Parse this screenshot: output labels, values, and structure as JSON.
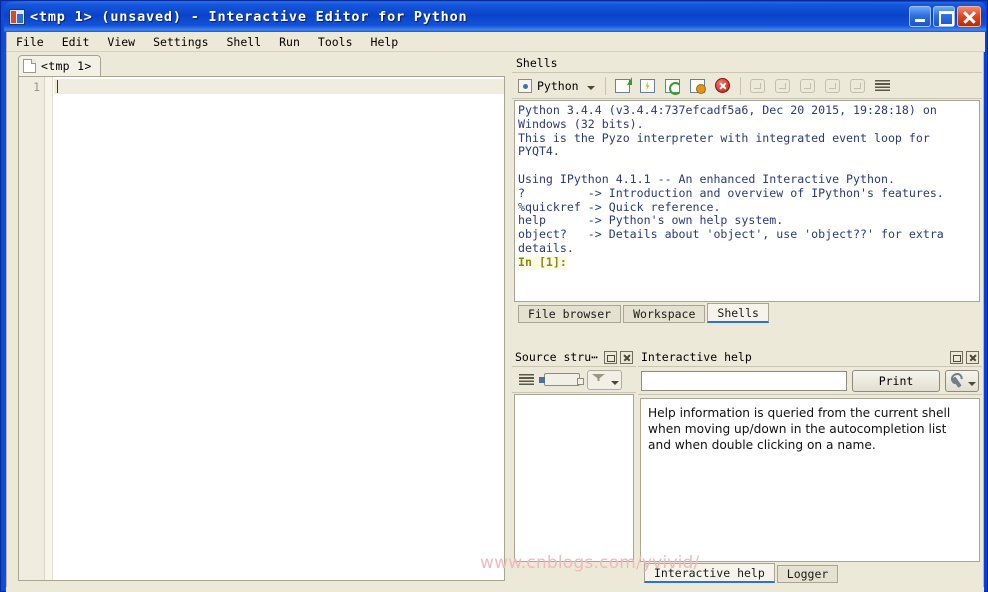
{
  "window": {
    "title": "<tmp 1> (unsaved) - Interactive Editor for Python",
    "icon": "pyzo-app-icon",
    "controls": {
      "minimize": "minimize-button",
      "maximize": "maximize-button",
      "close": "close-button"
    }
  },
  "menubar": {
    "items": [
      {
        "label": "File"
      },
      {
        "label": "Edit"
      },
      {
        "label": "View"
      },
      {
        "label": "Settings"
      },
      {
        "label": "Shell"
      },
      {
        "label": "Run"
      },
      {
        "label": "Tools"
      },
      {
        "label": "Help"
      }
    ]
  },
  "editor": {
    "tab": {
      "label": "<tmp 1>",
      "icon": "document-icon"
    },
    "lines": [
      {
        "number": "1",
        "text": ""
      }
    ]
  },
  "shells": {
    "panel_title": "Shells",
    "selector": {
      "label": "Python",
      "icon": "python-shell-icon"
    },
    "toolbar": [
      {
        "name": "new-shell-icon"
      },
      {
        "name": "debug-shell-icon"
      },
      {
        "name": "restart-shell-icon"
      },
      {
        "name": "shell-config-icon"
      },
      {
        "name": "terminate-shell-icon"
      },
      {
        "name": "debug-pause-icon"
      },
      {
        "name": "debug-step-icon"
      },
      {
        "name": "debug-stepin-icon"
      },
      {
        "name": "debug-stepout-icon"
      },
      {
        "name": "debug-stop-icon"
      },
      {
        "name": "postmortem-icon"
      }
    ],
    "console_output": "Python 3.4.4 (v3.4.4:737efcadf5a6, Dec 20 2015, 19:28:18) on Windows (32 bits).\nThis is the Pyzo interpreter with integrated event loop for PYQT4.\n\nUsing IPython 4.1.1 -- An enhanced Interactive Python.\n?         -> Introduction and overview of IPython's features.\n%quickref -> Quick reference.\nhelp      -> Python's own help system.\nobject?   -> Details about 'object', use 'object??' for extra details.\n",
    "prompt": "In [1]:",
    "tabs": [
      {
        "label": "File browser",
        "active": false
      },
      {
        "label": "Workspace",
        "active": false
      },
      {
        "label": "Shells",
        "active": true
      }
    ]
  },
  "source_structure": {
    "title": "Source stru⋯",
    "buttons": {
      "float": "float-panel-icon",
      "close": "close-panel-icon"
    },
    "toolbar": [
      {
        "name": "show-lines-icon"
      },
      {
        "name": "navigation-combo-icon"
      },
      {
        "name": "filter-funnel-icon"
      }
    ]
  },
  "interactive_help": {
    "title": "Interactive help",
    "buttons": {
      "float": "float-panel-icon",
      "close": "close-panel-icon"
    },
    "search_value": "",
    "search_placeholder": "",
    "print_label": "Print",
    "tool_icon": "wrench-icon",
    "body_text": "Help information is queried from the current shell when moving up/down in the autocompletion list and when double clicking on a name.",
    "tabs": [
      {
        "label": "Interactive help",
        "active": true
      },
      {
        "label": "Logger",
        "active": false
      }
    ]
  },
  "watermark": {
    "text": "www.cnblogs.com/yvivid/",
    "color": "#f0b9bc"
  },
  "colors": {
    "titlebar_blue": "#0b43c8",
    "client_bg": "#ece9d8",
    "console_text": "#2a3a7a",
    "prompt_olive": "#8a8a12",
    "active_tab_underline": "#2f6fd8"
  }
}
